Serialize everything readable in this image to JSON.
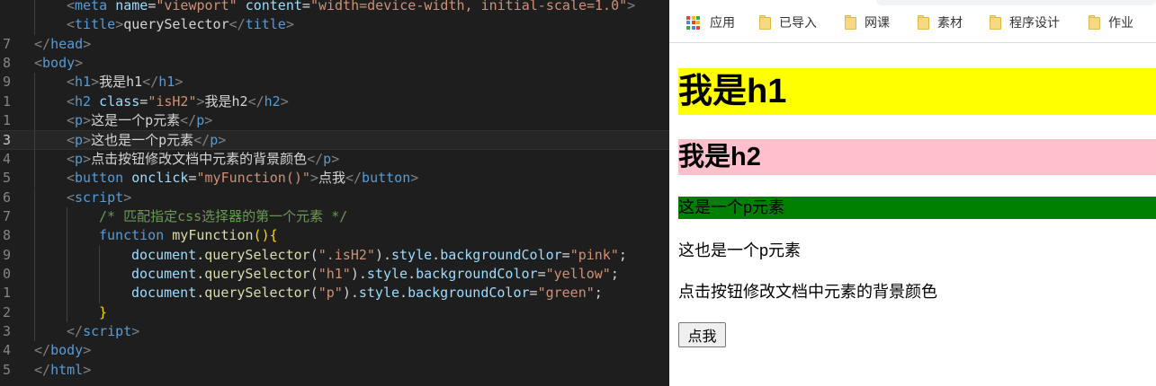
{
  "editor": {
    "lines": [
      {
        "num": "",
        "indent": 2,
        "spans": [
          [
            "br",
            "<"
          ],
          [
            "tag",
            "meta"
          ],
          [
            "txt",
            " "
          ],
          [
            "attr",
            "name"
          ],
          [
            "txt",
            "="
          ],
          [
            "str",
            "\"viewport\""
          ],
          [
            "txt",
            " "
          ],
          [
            "attr",
            "content"
          ],
          [
            "txt",
            "="
          ],
          [
            "str",
            "\"width=device-width, initial-scale=1.0\""
          ],
          [
            "br",
            ">"
          ]
        ]
      },
      {
        "num": "",
        "indent": 2,
        "spans": [
          [
            "br",
            "<"
          ],
          [
            "tag",
            "title"
          ],
          [
            "br",
            ">"
          ],
          [
            "txt",
            "querySelector"
          ],
          [
            "br",
            "</"
          ],
          [
            "tag",
            "title"
          ],
          [
            "br",
            ">"
          ]
        ]
      },
      {
        "num": "7",
        "indent": 1,
        "spans": [
          [
            "br",
            "</"
          ],
          [
            "tag",
            "head"
          ],
          [
            "br",
            ">"
          ]
        ]
      },
      {
        "num": "8",
        "indent": 1,
        "spans": [
          [
            "br",
            "<"
          ],
          [
            "tag",
            "body"
          ],
          [
            "br",
            ">"
          ]
        ]
      },
      {
        "num": "9",
        "indent": 2,
        "spans": [
          [
            "br",
            "<"
          ],
          [
            "tag",
            "h1"
          ],
          [
            "br",
            ">"
          ],
          [
            "txt",
            "我是h1"
          ],
          [
            "br",
            "</"
          ],
          [
            "tag",
            "h1"
          ],
          [
            "br",
            ">"
          ]
        ]
      },
      {
        "num": "1",
        "indent": 2,
        "spans": [
          [
            "br",
            "<"
          ],
          [
            "tag",
            "h2"
          ],
          [
            "txt",
            " "
          ],
          [
            "attr",
            "class"
          ],
          [
            "txt",
            "="
          ],
          [
            "str",
            "\"isH2\""
          ],
          [
            "br",
            ">"
          ],
          [
            "txt",
            "我是h2"
          ],
          [
            "br",
            "</"
          ],
          [
            "tag",
            "h2"
          ],
          [
            "br",
            ">"
          ]
        ]
      },
      {
        "num": "1",
        "indent": 2,
        "spans": [
          [
            "br",
            "<"
          ],
          [
            "tag",
            "p"
          ],
          [
            "br",
            ">"
          ],
          [
            "txt",
            "这是一个p元素"
          ],
          [
            "br",
            "</"
          ],
          [
            "tag",
            "p"
          ],
          [
            "br",
            ">"
          ]
        ]
      },
      {
        "num": "3",
        "indent": 2,
        "active": true,
        "spans": [
          [
            "br",
            "<"
          ],
          [
            "tag",
            "p"
          ],
          [
            "br",
            ">"
          ],
          [
            "txt",
            "这也是一个p元素"
          ],
          [
            "br",
            "</"
          ],
          [
            "tag",
            "p"
          ],
          [
            "br",
            ">"
          ]
        ]
      },
      {
        "num": "4",
        "indent": 2,
        "spans": [
          [
            "br",
            "<"
          ],
          [
            "tag",
            "p"
          ],
          [
            "br",
            ">"
          ],
          [
            "txt",
            "点击按钮修改文档中元素的背景颜色"
          ],
          [
            "br",
            "</"
          ],
          [
            "tag",
            "p"
          ],
          [
            "br",
            ">"
          ]
        ]
      },
      {
        "num": "5",
        "indent": 2,
        "spans": [
          [
            "br",
            "<"
          ],
          [
            "tag",
            "button"
          ],
          [
            "txt",
            " "
          ],
          [
            "attr",
            "onclick"
          ],
          [
            "txt",
            "="
          ],
          [
            "str",
            "\"myFunction()\""
          ],
          [
            "br",
            ">"
          ],
          [
            "txt",
            "点我"
          ],
          [
            "br",
            "</"
          ],
          [
            "tag",
            "button"
          ],
          [
            "br",
            ">"
          ]
        ]
      },
      {
        "num": "6",
        "indent": 2,
        "spans": [
          [
            "br",
            "<"
          ],
          [
            "tag",
            "script"
          ],
          [
            "br",
            ">"
          ]
        ]
      },
      {
        "num": "7",
        "indent": 3,
        "spans": [
          [
            "cmt",
            "/* 匹配指定css选择器的第一个元素 */"
          ]
        ]
      },
      {
        "num": "8",
        "indent": 3,
        "spans": [
          [
            "kw",
            "function"
          ],
          [
            "txt",
            " "
          ],
          [
            "fn",
            "myFunction"
          ],
          [
            "brace",
            "(){"
          ]
        ]
      },
      {
        "num": "9",
        "indent": 4,
        "spans": [
          [
            "attr",
            "document"
          ],
          [
            "txt",
            "."
          ],
          [
            "fn",
            "querySelector"
          ],
          [
            "txt",
            "("
          ],
          [
            "str",
            "\".isH2\""
          ],
          [
            "txt",
            ")."
          ],
          [
            "attr",
            "style"
          ],
          [
            "txt",
            "."
          ],
          [
            "attr",
            "backgroundColor"
          ],
          [
            "txt",
            "="
          ],
          [
            "str",
            "\"pink\""
          ],
          [
            "txt",
            ";"
          ]
        ]
      },
      {
        "num": "0",
        "indent": 4,
        "spans": [
          [
            "attr",
            "document"
          ],
          [
            "txt",
            "."
          ],
          [
            "fn",
            "querySelector"
          ],
          [
            "txt",
            "("
          ],
          [
            "str",
            "\"h1\""
          ],
          [
            "txt",
            ")."
          ],
          [
            "attr",
            "style"
          ],
          [
            "txt",
            "."
          ],
          [
            "attr",
            "backgroundColor"
          ],
          [
            "txt",
            "="
          ],
          [
            "str",
            "\"yellow\""
          ],
          [
            "txt",
            ";"
          ]
        ]
      },
      {
        "num": "1",
        "indent": 4,
        "spans": [
          [
            "attr",
            "document"
          ],
          [
            "txt",
            "."
          ],
          [
            "fn",
            "querySelector"
          ],
          [
            "txt",
            "("
          ],
          [
            "str",
            "\"p\""
          ],
          [
            "txt",
            ")."
          ],
          [
            "attr",
            "style"
          ],
          [
            "txt",
            "."
          ],
          [
            "attr",
            "backgroundColor"
          ],
          [
            "txt",
            "="
          ],
          [
            "str",
            "\"green\""
          ],
          [
            "txt",
            ";"
          ]
        ]
      },
      {
        "num": "2",
        "indent": 3,
        "spans": [
          [
            "brace",
            "}"
          ]
        ]
      },
      {
        "num": "3",
        "indent": 2,
        "spans": [
          [
            "br",
            "</"
          ],
          [
            "tag",
            "script"
          ],
          [
            "br",
            ">"
          ]
        ]
      },
      {
        "num": "4",
        "indent": 1,
        "spans": [
          [
            "br",
            "</"
          ],
          [
            "tag",
            "body"
          ],
          [
            "br",
            ">"
          ]
        ]
      },
      {
        "num": "5",
        "indent": 1,
        "spans": [
          [
            "br",
            "</"
          ],
          [
            "tag",
            "html"
          ],
          [
            "br",
            ">"
          ]
        ]
      }
    ]
  },
  "browser": {
    "bookmarks": [
      {
        "label": "应用",
        "icon": "apps-grid-icon"
      },
      {
        "label": "已导入",
        "icon": "folder-icon"
      },
      {
        "label": "网课",
        "icon": "folder-icon"
      },
      {
        "label": "素材",
        "icon": "folder-icon"
      },
      {
        "label": "程序设计",
        "icon": "folder-icon"
      },
      {
        "label": "作业",
        "icon": "folder-icon"
      }
    ],
    "page": {
      "h1": "我是h1",
      "h2": "我是h2",
      "p1": "这是一个p元素",
      "p2": "这也是一个p元素",
      "p3": "点击按钮修改文档中元素的背景颜色",
      "button": "点我"
    },
    "colors": {
      "h1_bg": "#ffff00",
      "h2_bg": "#ffc0cb",
      "p1_bg": "#008000"
    }
  }
}
